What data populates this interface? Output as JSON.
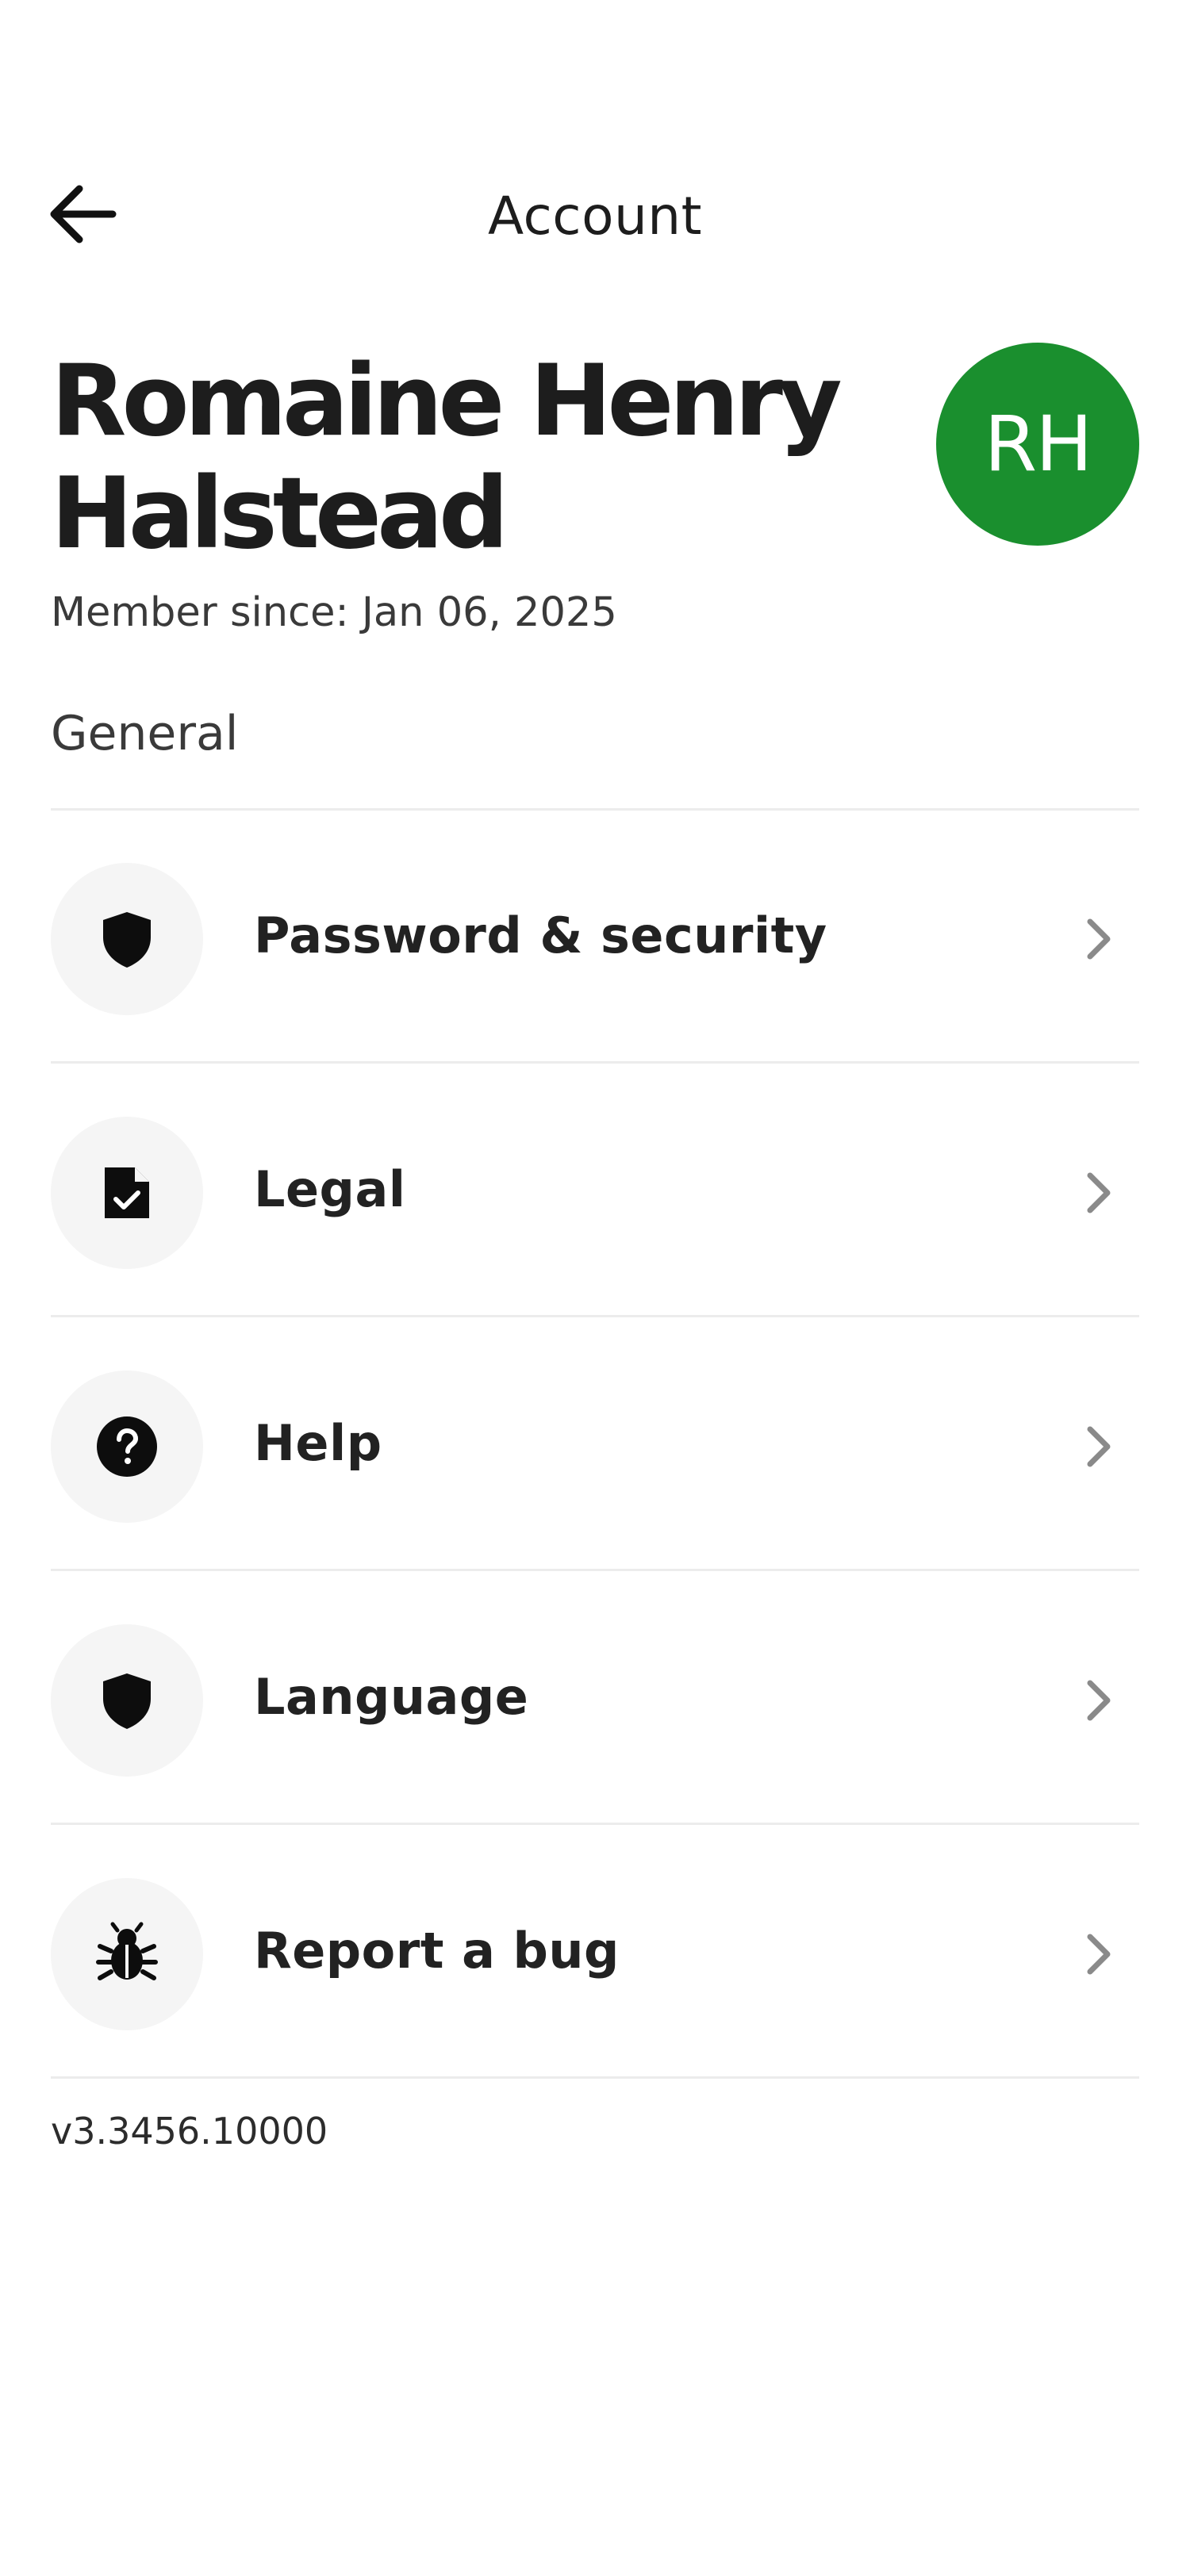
{
  "header": {
    "title": "Account"
  },
  "profile": {
    "name": "Romaine Henry Halstead",
    "member_since": "Member since: Jan 06, 2025",
    "initials": "RH",
    "avatar_color": "#1a8f2e"
  },
  "section": {
    "label": "General"
  },
  "menu": {
    "items": [
      {
        "label": "Password & security",
        "icon": "shield-icon"
      },
      {
        "label": "Legal",
        "icon": "document-check-icon"
      },
      {
        "label": "Help",
        "icon": "help-circle-icon"
      },
      {
        "label": "Language",
        "icon": "shield-icon"
      },
      {
        "label": "Report a bug",
        "icon": "bug-icon"
      }
    ]
  },
  "footer": {
    "version": "v3.3456.10000"
  }
}
